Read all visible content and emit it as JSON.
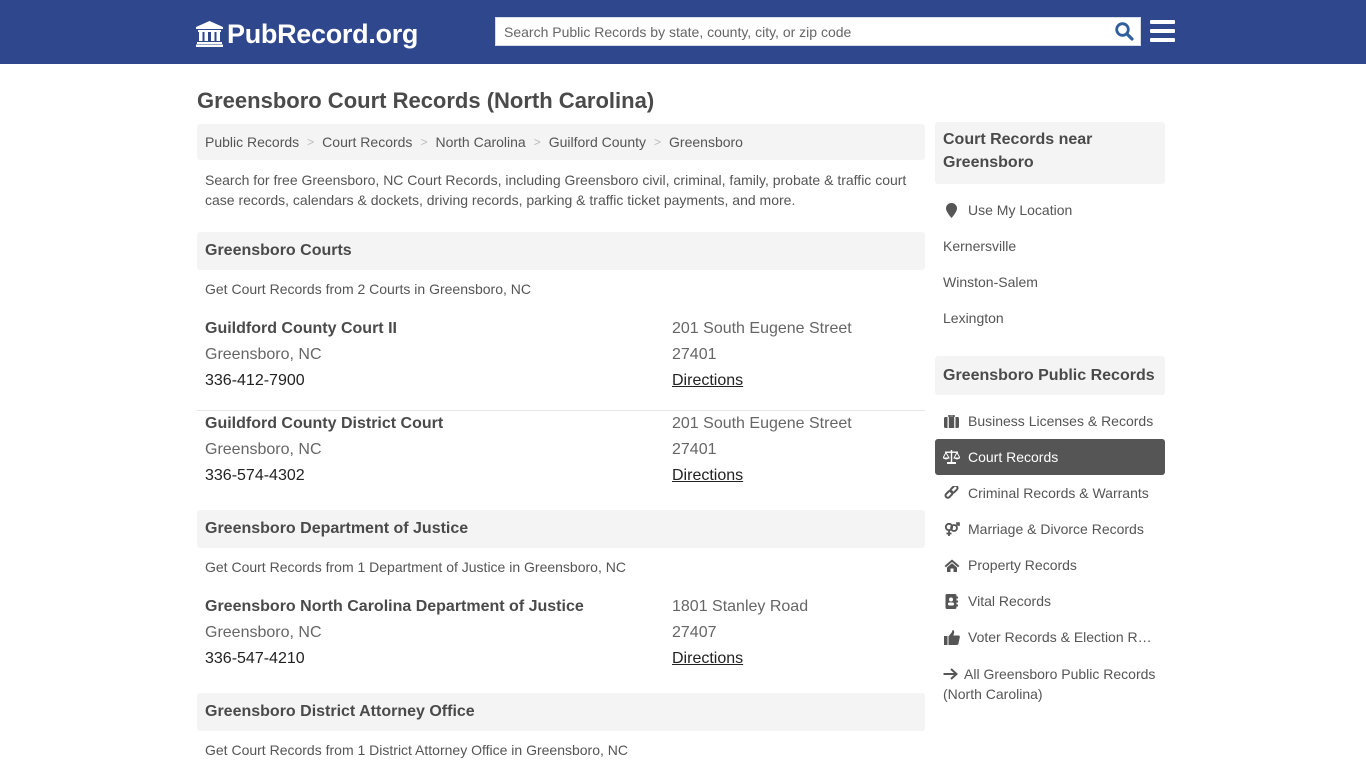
{
  "header": {
    "logo_text": "PubRecord.org",
    "search_placeholder": "Search Public Records by state, county, city, or zip code",
    "search_value": "",
    "brand_color": "#2f478c"
  },
  "page": {
    "title": "Greensboro Court Records (North Carolina)",
    "breadcrumb": [
      "Public Records",
      "Court Records",
      "North Carolina",
      "Guilford County",
      "Greensboro"
    ],
    "intro": "Search for free Greensboro, NC Court Records, including Greensboro civil, criminal, family, probate & traffic court case records, calendars & dockets, driving records, parking & traffic ticket payments, and more."
  },
  "sections": [
    {
      "title": "Greensboro Courts",
      "subtitle": "Get Court Records from 2 Courts in Greensboro, NC",
      "entries": [
        {
          "name": "Guildford County Court II",
          "city": "Greensboro, NC",
          "phone": "336-412-7900",
          "address": "201 South Eugene Street",
          "zip": "27401",
          "link": "Directions"
        },
        {
          "name": "Guildford County District Court",
          "city": "Greensboro, NC",
          "phone": "336-574-4302",
          "address": "201 South Eugene Street",
          "zip": "27401",
          "link": "Directions"
        }
      ]
    },
    {
      "title": "Greensboro Department of Justice",
      "subtitle": "Get Court Records from 1 Department of Justice in Greensboro, NC",
      "entries": [
        {
          "name": "Greensboro North Carolina Department of Justice",
          "city": "Greensboro, NC",
          "phone": "336-547-4210",
          "address": "1801 Stanley Road",
          "zip": "27407",
          "link": "Directions"
        }
      ]
    },
    {
      "title": "Greensboro District Attorney Office",
      "subtitle": "Get Court Records from 1 District Attorney Office in Greensboro, NC",
      "entries": []
    }
  ],
  "sidebar": {
    "nearby": {
      "title": "Court Records near Greensboro",
      "use_location": "Use My Location",
      "cities": [
        "Kernersville",
        "Winston-Salem",
        "Lexington"
      ]
    },
    "public_records": {
      "title": "Greensboro Public Records",
      "items": [
        {
          "label": "Business Licenses & Records",
          "icon": "briefcase-icon",
          "active": false
        },
        {
          "label": "Court Records",
          "icon": "scales-icon",
          "active": true
        },
        {
          "label": "Criminal Records & Warrants",
          "icon": "link-icon",
          "active": false
        },
        {
          "label": "Marriage & Divorce Records",
          "icon": "gender-icon",
          "active": false
        },
        {
          "label": "Property Records",
          "icon": "home-icon",
          "active": false
        },
        {
          "label": "Vital Records",
          "icon": "address-book-icon",
          "active": false
        },
        {
          "label": "Voter Records & Election Records",
          "icon": "thumbs-up-icon",
          "active": false
        }
      ],
      "all_link": "All Greensboro Public Records (North Carolina)"
    }
  }
}
